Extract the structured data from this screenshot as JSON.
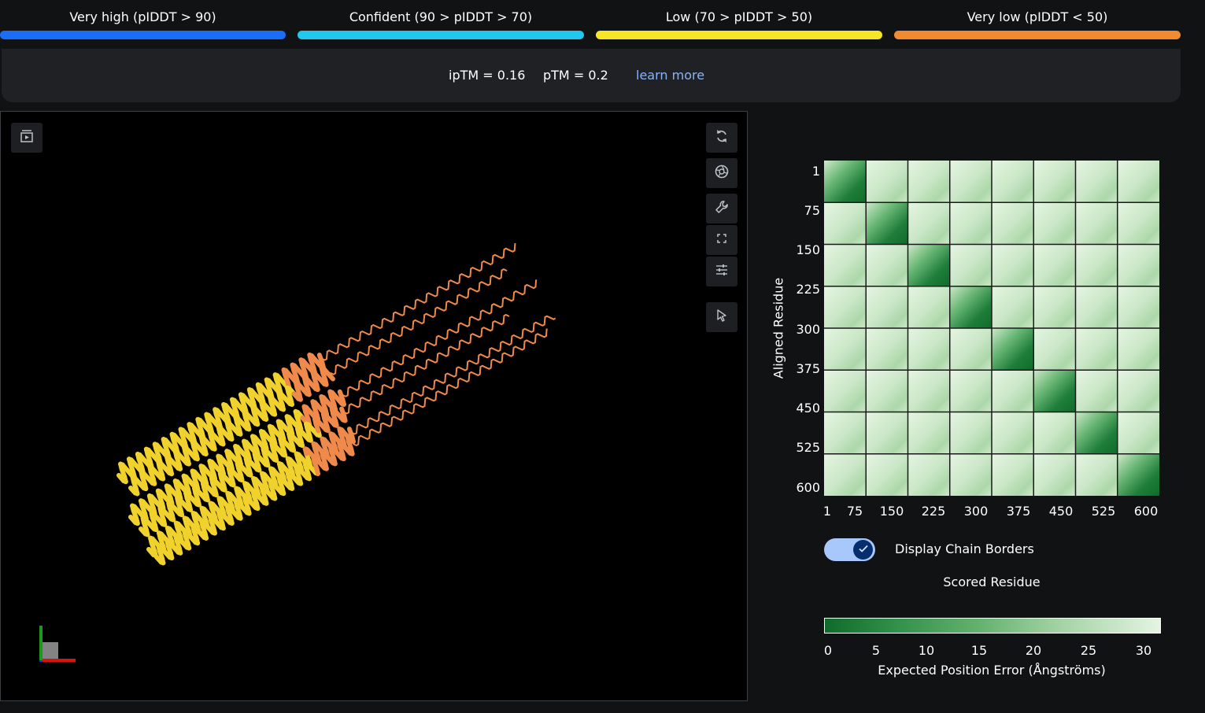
{
  "legend": {
    "items": [
      {
        "label": "Very high (pIDDT > 90)",
        "color": "#1a6ef5"
      },
      {
        "label": "Confident (90 > pIDDT > 70)",
        "color": "#1fc8ec"
      },
      {
        "label": "Low (70 > pIDDT > 50)",
        "color": "#f6e627"
      },
      {
        "label": "Very low (pIDDT < 50)",
        "color": "#f18b30"
      }
    ]
  },
  "metrics": {
    "iptm": "ipTM = 0.16",
    "ptm": "pTM = 0.2",
    "learn_more": "learn more"
  },
  "viewer": {
    "toolbar_icons": [
      "play-panel-icon",
      "rotate-icon",
      "camera-icon",
      "wrench-icon",
      "fullscreen-icon",
      "sliders-icon",
      "pointer-icon"
    ],
    "structure_colors": {
      "low": "#f1d22d",
      "very_low": "#f08a4b"
    }
  },
  "pae": {
    "ylabel": "Aligned Residue",
    "ytick_labels": [
      "1",
      "75",
      "150",
      "225",
      "300",
      "375",
      "450",
      "525",
      "600"
    ],
    "xtick_labels": [
      "1",
      "75",
      "150",
      "225",
      "300",
      "375",
      "450",
      "525",
      "600"
    ],
    "num_chains": 8,
    "toggle_label": "Display Chain Borders",
    "toggle_on": true,
    "xlabel": "Scored Residue",
    "colorbar_ticks": [
      "0",
      "5",
      "10",
      "15",
      "20",
      "25",
      "30"
    ],
    "colorbar_label": "Expected Position Error (Ångströms)",
    "colorbar_colors": {
      "low": "#0f6b2a",
      "high": "#e4f4e2"
    }
  }
}
